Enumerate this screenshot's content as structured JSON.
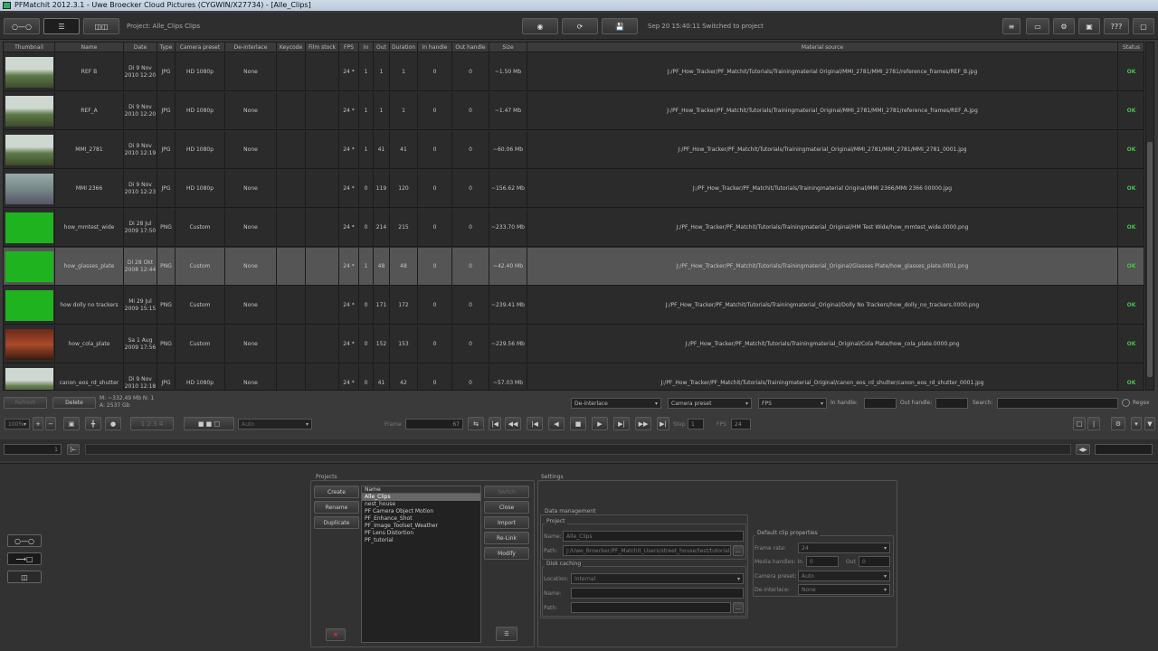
{
  "window": {
    "title": "PFMatchit 2012.3.1 - Uwe Broecker Cloud Pictures (CYGWIN/X27734) - [Alle_Clips]"
  },
  "toolbar": {
    "project_label": "Project: Alle_Clips  Clips",
    "status_text": "Sep 20 15:40:11 Switched to project",
    "help_label": "???"
  },
  "table": {
    "columns": [
      "Thumbnail",
      "Name",
      "Date",
      "Type",
      "Camera preset",
      "De-interlace",
      "Keycode",
      "Film stock",
      "FPS",
      "In",
      "Out",
      "Duration",
      "In handle",
      "Out handle",
      "Size",
      "Material source",
      "Status"
    ],
    "rows": [
      {
        "thumb": "graveyard",
        "name": "REF B",
        "date": "Di 9 Nov\n2010 12:20",
        "type": "JPG",
        "preset": "HD 1080p",
        "deint": "None",
        "keycode": "",
        "film": "",
        "fps": "24 *",
        "in": "1",
        "out": "1",
        "dur": "1",
        "inh": "0",
        "outh": "0",
        "size": "~1.50 Mb",
        "source": "J:/PF_How_Tracker/PF_Matchit/Tutorials/Trainingmaterial Original/MMI_2781/MMI_2781/reference_frames/REF_B.jpg",
        "status": "OK"
      },
      {
        "thumb": "graveyard",
        "name": "REF_A",
        "date": "Di 9 Nov\n2010 12:20",
        "type": "JPG",
        "preset": "HD 1080p",
        "deint": "None",
        "keycode": "",
        "film": "",
        "fps": "24 *",
        "in": "1",
        "out": "1",
        "dur": "1",
        "inh": "0",
        "outh": "0",
        "size": "~1.47 Mb",
        "source": "J:/PF_How_Tracker/PF_Matchit/Tutorials/Trainingmaterial_Original/MMI_2781/MMI_2781/reference_frames/REF_A.jpg",
        "status": "OK"
      },
      {
        "thumb": "graveyard",
        "name": "MMI_2781",
        "date": "Di 9 Nov\n2010 12:19",
        "type": "JPG",
        "preset": "HD 1080p",
        "deint": "None",
        "keycode": "",
        "film": "",
        "fps": "24 *",
        "in": "1",
        "out": "41",
        "dur": "41",
        "inh": "0",
        "outh": "0",
        "size": "~60.06 Mb",
        "source": "J:/PF_How_Tracker/PF_Matchit/Tutorials/Trainingmaterial_Original/MMI_2781/MMI_2781/MMI_2781_0001.jpg",
        "status": "OK"
      },
      {
        "thumb": "street",
        "name": "MMI 2366",
        "date": "Di 9 Nov\n2010 12:23",
        "type": "JPG",
        "preset": "HD 1080p",
        "deint": "None",
        "keycode": "",
        "film": "",
        "fps": "24 *",
        "in": "0",
        "out": "119",
        "dur": "120",
        "inh": "0",
        "outh": "0",
        "size": "~156.62 Mb",
        "source": "J:/PF_How_Tracker/PF_Matchit/Tutorials/Trainingmaterial Original/MMI 2366/MMI 2366 00000.jpg",
        "status": "OK"
      },
      {
        "thumb": "green",
        "name": "how_mmtest_wide",
        "date": "Di 28 Jul\n2009 17:50",
        "type": "PNG",
        "preset": "Custom",
        "deint": "None",
        "keycode": "",
        "film": "",
        "fps": "24 *",
        "in": "0",
        "out": "214",
        "dur": "215",
        "inh": "0",
        "outh": "0",
        "size": "~233.70 Mb",
        "source": "J:/PF_How_Tracker/PF_Matchit/Tutorials/Trainingmaterial_Original/HM Test Wide/how_mmtest_wide.0000.png",
        "status": "OK"
      },
      {
        "thumb": "green",
        "name": "how_glasses_plate",
        "date": "Di 28 Okt\n2008 12:44",
        "type": "PNG",
        "preset": "Custom",
        "deint": "None",
        "keycode": "",
        "film": "",
        "fps": "24 *",
        "in": "1",
        "out": "48",
        "dur": "48",
        "inh": "0",
        "outh": "0",
        "size": "~42.40 Mb",
        "source": "J:/PF_How_Tracker/PF_Matchit/Tutorials/Trainingmaterial_Original/Glasses Plate/how_glasses_plate.0001.png",
        "status": "OK",
        "selected": true
      },
      {
        "thumb": "green",
        "name": "how dolly no trackers",
        "date": "Mi 29 Jul\n2009 15:15",
        "type": "PNG",
        "preset": "Custom",
        "deint": "None",
        "keycode": "",
        "film": "",
        "fps": "24 *",
        "in": "0",
        "out": "171",
        "dur": "172",
        "inh": "0",
        "outh": "0",
        "size": "~239.41 Mb",
        "source": "J:/PF_How_Tracker/PF_Matchit/Tutorials/Trainingmaterial_Original/Dolly No Trackers/how_dolly_no_trackers.0000.png",
        "status": "OK"
      },
      {
        "thumb": "red",
        "name": "how_cola_plate",
        "date": "Sa 1 Aug\n2009 17:56",
        "type": "PNG",
        "preset": "Custom",
        "deint": "None",
        "keycode": "",
        "film": "",
        "fps": "24 *",
        "in": "0",
        "out": "152",
        "dur": "153",
        "inh": "0",
        "outh": "0",
        "size": "~229.56 Mb",
        "source": "J:/PF_How_Tracker/PF_Matchit/Tutorials/Trainingmaterial_Original/Cola Plate/how_cola_plate.0000.png",
        "status": "OK"
      },
      {
        "thumb": "graveyard",
        "name": "canon_eos_rd_shutter",
        "date": "Di 9 Nov\n2010 12:18",
        "type": "JPG",
        "preset": "HD 1080p",
        "deint": "None",
        "keycode": "",
        "film": "",
        "fps": "24 *",
        "in": "0",
        "out": "41",
        "dur": "42",
        "inh": "0",
        "outh": "0",
        "size": "~57.03 Mb",
        "source": "J:/PF_How_Tracker/PF_Matchit/Tutorials/Trainingmaterial_Original/canon_eos_rd_shutter/canon_eos_rd_shutter_0001.jpg",
        "status": "OK"
      }
    ]
  },
  "filters": {
    "refresh_label": "Refresh",
    "delete_label": "Delete",
    "memory_text": "M: ~332.49 Mb   N: 1\nA: 2537 Gb",
    "deinterlace": "De-interlace",
    "camera_preset": "Camera preset",
    "fps": "FPS",
    "in_handle_label": "In handle:",
    "out_handle_label": "Out handle:",
    "search_label": "Search:",
    "regex_label": "Regex"
  },
  "player": {
    "zoom": "100%",
    "auto_label": "Auto",
    "frame_label": "Frame",
    "frame_value": "67",
    "step_label": "Step",
    "step_value": "1",
    "fps_label": "FPS",
    "fps_value": "24",
    "start_frame": "1"
  },
  "projects": {
    "title": "Projects",
    "create_label": "Create",
    "rename_label": "Rename",
    "duplicate_label": "Duplicate",
    "list_header": "Name",
    "items": [
      "Alle_Clips",
      "nest_house",
      "PF Camera Object Motion",
      "PF_Enhance_Shot",
      "PF_Image_Toolset_Weather",
      "PF Lens Distortion",
      "PF_tutorial"
    ],
    "switch_label": "Switch",
    "close_label": "Close",
    "import_label": "Import",
    "relink_label": "Re-Link",
    "modify_label": "Modify"
  },
  "settings": {
    "title": "Settings",
    "data_management": "Data management",
    "project_group": "Project",
    "name_label": "Name:",
    "name_value": "Alle_Clips",
    "path_label": "Path:",
    "path_value": "J:/Uwe_Broecker/PF_Matchit_Users/street_house/test/tutorials",
    "disk_caching": "Disk caching",
    "location_label": "Location:",
    "location_value": "Internal",
    "dc_name_label": "Name:",
    "dc_path_label": "Path:",
    "default_clip_props": "Default clip properties",
    "frame_rate_label": "Frame rate:",
    "frame_rate_value": "24",
    "media_handles_label": "Media handles: In",
    "media_in": "0",
    "media_out_label": "Out",
    "media_out": "0",
    "camera_preset_label": "Camera preset:",
    "camera_preset_value": "Auto",
    "deinterlace_label": "De-interlace:",
    "deinterlace_value": "None"
  },
  "colors": {
    "ok": "#49c149",
    "accent": "#d03030"
  }
}
